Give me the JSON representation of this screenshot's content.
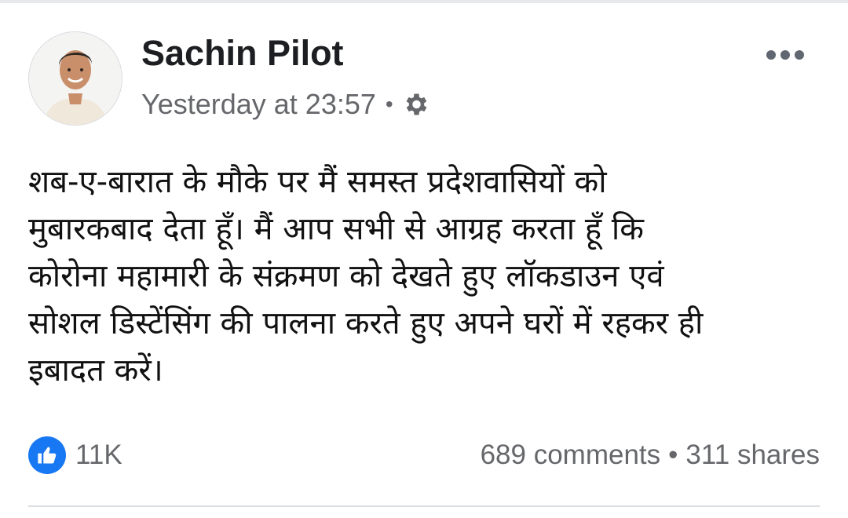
{
  "post": {
    "author": "Sachin Pilot",
    "timestamp": "Yesterday at 23:57",
    "separator": "•",
    "privacy_icon": "gear-icon",
    "text": "शब-ए-बारात के मौके पर मैं समस्त प्रदेशवासियों को\nमुबारकबाद देता हूँ। मैं आप सभी से आग्रह करता हूँ कि\nकोरोना महामारी के संक्रमण को देखते हुए लॉकडाउन एवं\nसोशल डिस्टेंसिंग की पालना करते हुए अपने घरों में रहकर ही\nइबादत करें।",
    "likes": "11K",
    "comments": "689 comments",
    "stats_separator": "•",
    "shares": "311 shares"
  },
  "colors": {
    "accent": "#1877f2",
    "secondary_text": "#65676b"
  }
}
